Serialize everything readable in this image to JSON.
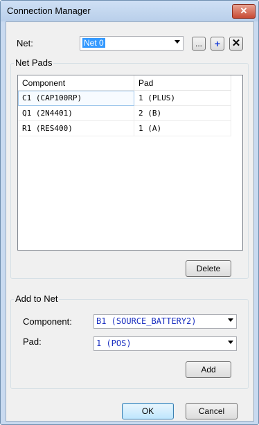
{
  "window": {
    "title": "Connection Manager",
    "close_label": "✕"
  },
  "net": {
    "label": "Net:",
    "value": "Net 0",
    "browse_label": "...",
    "add_label": "+",
    "delete_label": "✕"
  },
  "net_pads": {
    "group_title": "Net Pads",
    "columns": [
      "Component",
      "Pad"
    ],
    "rows": [
      [
        "C1 (CAP100RP)",
        "1 (PLUS)"
      ],
      [
        "Q1 (2N4401)",
        "2 (B)"
      ],
      [
        "R1 (RES400)",
        "1 (A)"
      ]
    ],
    "delete_label": "Delete"
  },
  "add_to_net": {
    "group_title": "Add to Net",
    "component_label": "Component:",
    "component_value": "B1 (SOURCE_BATTERY2)",
    "pad_label": "Pad:",
    "pad_value": "1 (POS)",
    "add_label": "Add"
  },
  "footer": {
    "ok_label": "OK",
    "cancel_label": "Cancel"
  }
}
